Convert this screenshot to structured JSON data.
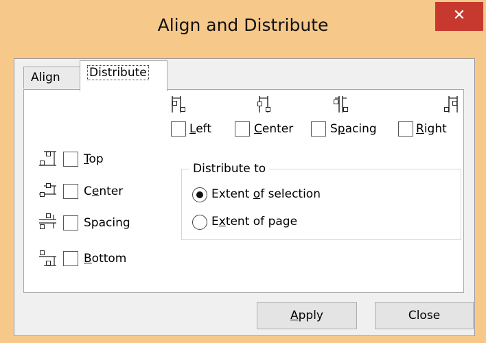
{
  "window": {
    "title": "Align and Distribute",
    "close_glyph": "✕"
  },
  "tabs": {
    "align": "Align",
    "distribute": "Distribute"
  },
  "horizontal": {
    "left": {
      "pre": "",
      "key": "L",
      "post": "eft",
      "checked": false
    },
    "center": {
      "pre": "",
      "key": "C",
      "post": "enter",
      "checked": false
    },
    "spacing": {
      "pre": "S",
      "key": "p",
      "post": "acing",
      "checked": false
    },
    "right": {
      "pre": "",
      "key": "R",
      "post": "ight",
      "checked": false
    }
  },
  "vertical": {
    "top": {
      "pre": "",
      "key": "T",
      "post": "op",
      "checked": false
    },
    "center": {
      "pre": "C",
      "key": "e",
      "post": "nter",
      "checked": false
    },
    "spacing": {
      "pre": "Spacin",
      "key": "g",
      "post": "",
      "checked": false
    },
    "bottom": {
      "pre": "",
      "key": "B",
      "post": "ottom",
      "checked": false
    }
  },
  "distribute_to": {
    "legend": "Distribute to",
    "selection": {
      "pre": "Extent ",
      "key": "o",
      "post": "f selection",
      "selected": true
    },
    "page": {
      "pre": "E",
      "key": "x",
      "post": "tent of page",
      "selected": false
    }
  },
  "buttons": {
    "apply": {
      "pre": "",
      "key": "A",
      "post": "pply"
    },
    "close": {
      "label": "Close"
    }
  },
  "icons": {
    "h_left": "distribute-left-icon",
    "h_center": "distribute-center-h-icon",
    "h_spacing": "distribute-spacing-h-icon",
    "h_right": "distribute-right-icon",
    "v_top": "distribute-top-icon",
    "v_center": "distribute-center-v-icon",
    "v_spacing": "distribute-spacing-v-icon",
    "v_bottom": "distribute-bottom-icon"
  }
}
